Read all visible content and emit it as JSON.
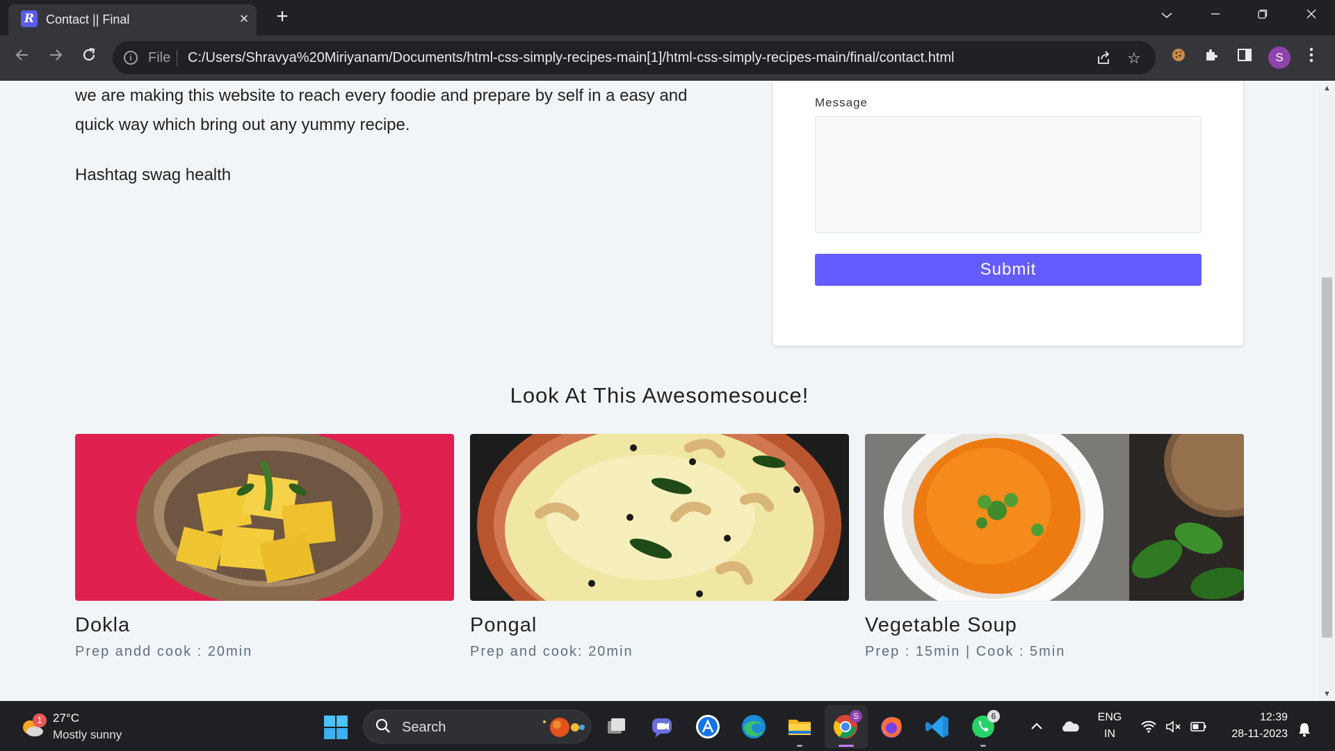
{
  "browser": {
    "tab_title": "Contact || Final",
    "tab_favicon_letter": "R",
    "file_label": "File",
    "url": "C:/Users/Shravya%20Miriyanam/Documents/html-css-simply-recipes-main[1]/html-css-simply-recipes-main/final/contact.html",
    "profile_initial": "S",
    "icons": [
      "back-icon",
      "forward-icon",
      "reload-icon",
      "info-icon",
      "share-icon",
      "star-icon",
      "cookie-icon",
      "extensions-icon",
      "side-panel-icon",
      "menu-icon"
    ]
  },
  "page": {
    "about": {
      "paragraph": "we are making this website to reach every foodie and prepare by self in a easy and quick way which bring out any yummy recipe.",
      "hashtag": "Hashtag swag health"
    },
    "form": {
      "message_label": "Message",
      "message_value": "",
      "submit_label": "Submit",
      "accent_color": "#645cff"
    },
    "featured": {
      "title": "Look At This Awesomesouce!",
      "recipes": [
        {
          "title": "Dokla",
          "meta": "Prep andd cook : 20min"
        },
        {
          "title": "Pongal",
          "meta": "Prep and cook: 20min"
        },
        {
          "title": "Vegetable Soup",
          "meta": "Prep : 15min | Cook : 5min"
        }
      ]
    }
  },
  "taskbar": {
    "weather_badge": "1",
    "temperature": "27°C",
    "condition": "Mostly sunny",
    "search_label": "Search",
    "chrome_badge": "S",
    "whatsapp_badge": "6",
    "language": "ENG",
    "region": "IN",
    "time": "12:39",
    "date": "28-11-2023"
  }
}
